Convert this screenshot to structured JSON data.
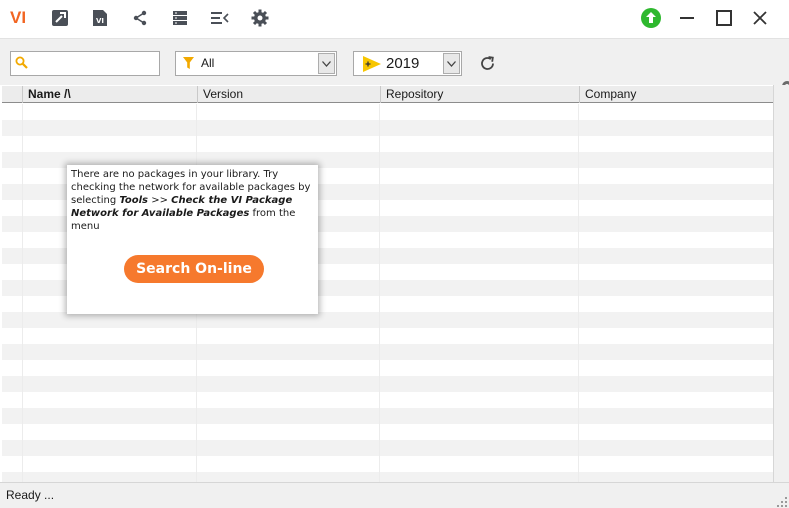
{
  "app": {
    "logo_text": "VI"
  },
  "titlebar": {
    "icons": [
      "hammer-icon",
      "vi-document-icon",
      "share-icon",
      "package-list-icon",
      "collapse-list-icon",
      "gear-icon"
    ],
    "update_icon": "upload-arrow-icon",
    "update_color": "#2eb82e"
  },
  "toolbar": {
    "search": {
      "value": "",
      "placeholder": ""
    },
    "filter": {
      "selected": "All"
    },
    "version": {
      "selected": "2019"
    }
  },
  "table": {
    "columns": [
      "Name  /\\",
      "Version",
      "Repository",
      "Company"
    ],
    "rows": []
  },
  "popup": {
    "message_start": "There are no packages in your library. Try checking the network for available packages by selecting ",
    "tools": "Tools",
    "separator": " >> ",
    "check_network": "Check the VI Package Network for Available Packages",
    "message_end": "  from the menu",
    "button_label": "Search On-line"
  },
  "status": {
    "text": "Ready ..."
  },
  "colors": {
    "accent": "#f26522",
    "button": "#f6792d",
    "update": "#2eb82e"
  }
}
